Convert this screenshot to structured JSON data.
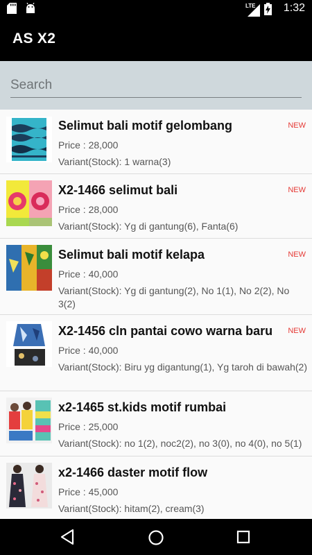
{
  "status_bar": {
    "time": "1:32",
    "network": "LTE",
    "left_icons": [
      "sd-card-icon",
      "android-icon"
    ],
    "right_icons": [
      "lte-signal-icon",
      "battery-charging-icon"
    ]
  },
  "app_bar": {
    "title": "AS X2"
  },
  "search": {
    "placeholder": "Search",
    "value": ""
  },
  "products": [
    {
      "name": "Selimut bali motif gelombang",
      "badge": "NEW",
      "price": "Price : 28,000",
      "variant": "Variant(Stock): 1 warna(3)"
    },
    {
      "name": "X2-1466 selimut bali",
      "badge": "NEW",
      "price": "Price : 28,000",
      "variant": "Variant(Stock): Yg di gantung(6), Fanta(6)"
    },
    {
      "name": "Selimut bali motif kelapa",
      "badge": "NEW",
      "price": "Price : 40,000",
      "variant": "Variant(Stock): Yg di gantung(2), No 1(1), No 2(2), No 3(2)"
    },
    {
      "name": "X2-1456 cln pantai cowo warna baru",
      "badge": "NEW",
      "price": "Price : 40,000",
      "variant": "Variant(Stock): Biru yg digantung(1), Yg taroh di bawah(2)"
    },
    {
      "name": "x2-1465 st.kids motif rumbai",
      "badge": "",
      "price": "Price : 25,000",
      "variant": "Variant(Stock): no 1(2), noc2(2), no 3(0), no 4(0), no 5(1)"
    },
    {
      "name": "x2-1466 daster motif flow",
      "badge": "",
      "price": "Price : 45,000",
      "variant": "Variant(Stock): hitam(2), cream(3)"
    }
  ],
  "nav_bar": {
    "buttons": [
      "back-icon",
      "home-icon",
      "recents-icon"
    ]
  }
}
